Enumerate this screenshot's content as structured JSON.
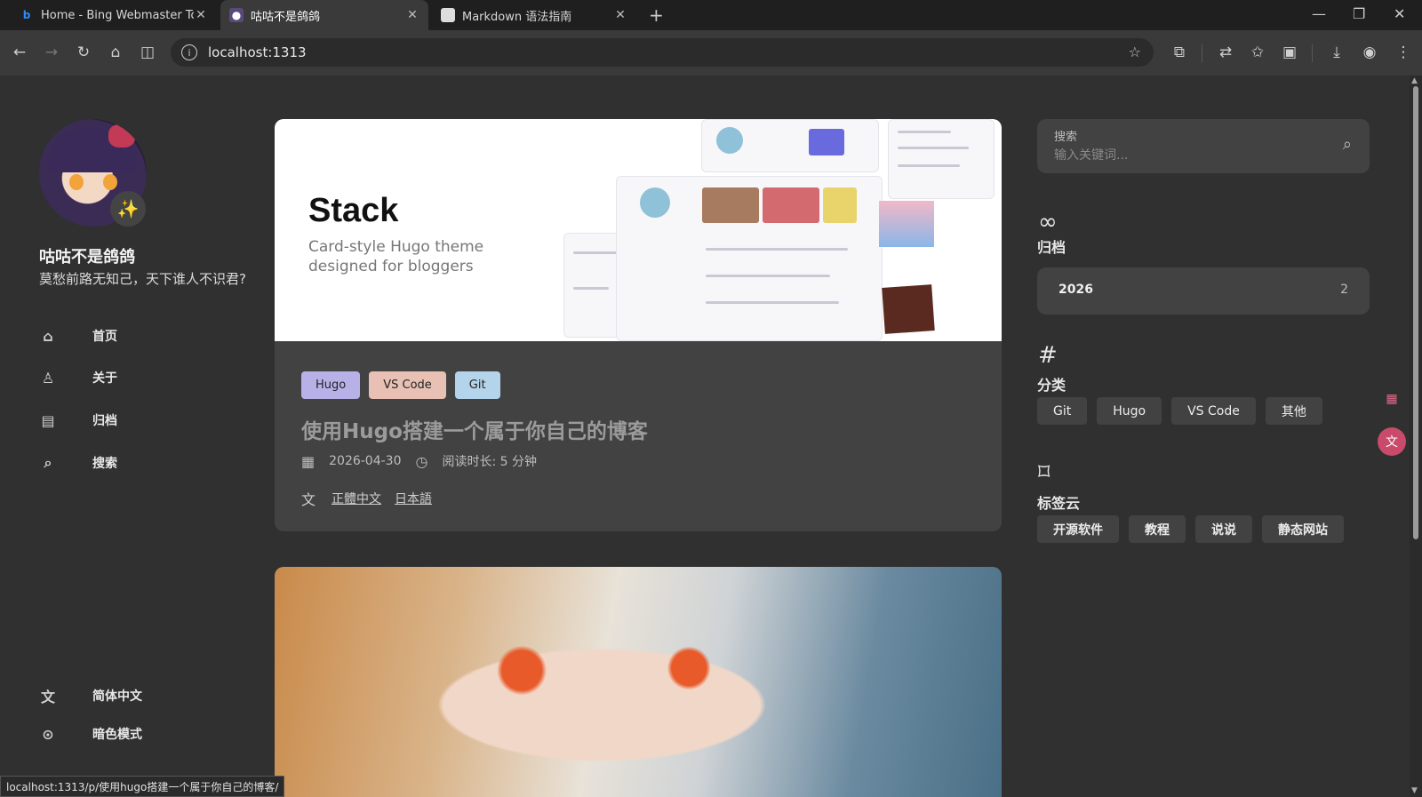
{
  "browser": {
    "tabs": [
      {
        "title": "Home - Bing Webmaster Too",
        "icon": "bing-icon"
      },
      {
        "title": "咕咕不是鸽鸽",
        "icon": "site-avatar-icon"
      },
      {
        "title": "Markdown 语法指南",
        "icon": "page-icon"
      }
    ],
    "url": "localhost:1313",
    "status_url": "localhost:1313/p/使用hugo搭建一个属于你自己的博客/"
  },
  "sidebar": {
    "site_name": "咕咕不是鸽鸽",
    "site_desc": "莫愁前路无知己，天下谁人不识君?",
    "avatar_emoji": "✨",
    "menu": [
      {
        "label": "首页",
        "icon": "home-icon"
      },
      {
        "label": "关于",
        "icon": "user-icon"
      },
      {
        "label": "归档",
        "icon": "archive-icon"
      },
      {
        "label": "搜索",
        "icon": "search-icon"
      }
    ],
    "language": "简体中文",
    "dark_mode": "暗色模式"
  },
  "post": {
    "hero_title": "Stack",
    "hero_sub1": "Card-style Hugo theme",
    "hero_sub2": "designed for bloggers",
    "tags": [
      {
        "label": "Hugo",
        "color": "#b8b1e8"
      },
      {
        "label": "VS Code",
        "color": "#e8c1b4"
      },
      {
        "label": "Git",
        "color": "#b4d4ec"
      }
    ],
    "title": "使用Hugo搭建一个属于你自己的博客",
    "date": "2026-04-30",
    "reading_time": "阅读时长: 5 分钟",
    "translations": [
      "正體中文",
      "日本語"
    ]
  },
  "right": {
    "search_label": "搜索",
    "search_placeholder": "输入关键词...",
    "archive_title": "归档",
    "archive_year": "2026",
    "archive_count": "2",
    "categories_title": "分类",
    "categories": [
      "Git",
      "Hugo",
      "VS Code",
      "其他"
    ],
    "tags_title": "标签云",
    "tags": [
      "开源软件",
      "教程",
      "说说",
      "静态网站"
    ]
  }
}
